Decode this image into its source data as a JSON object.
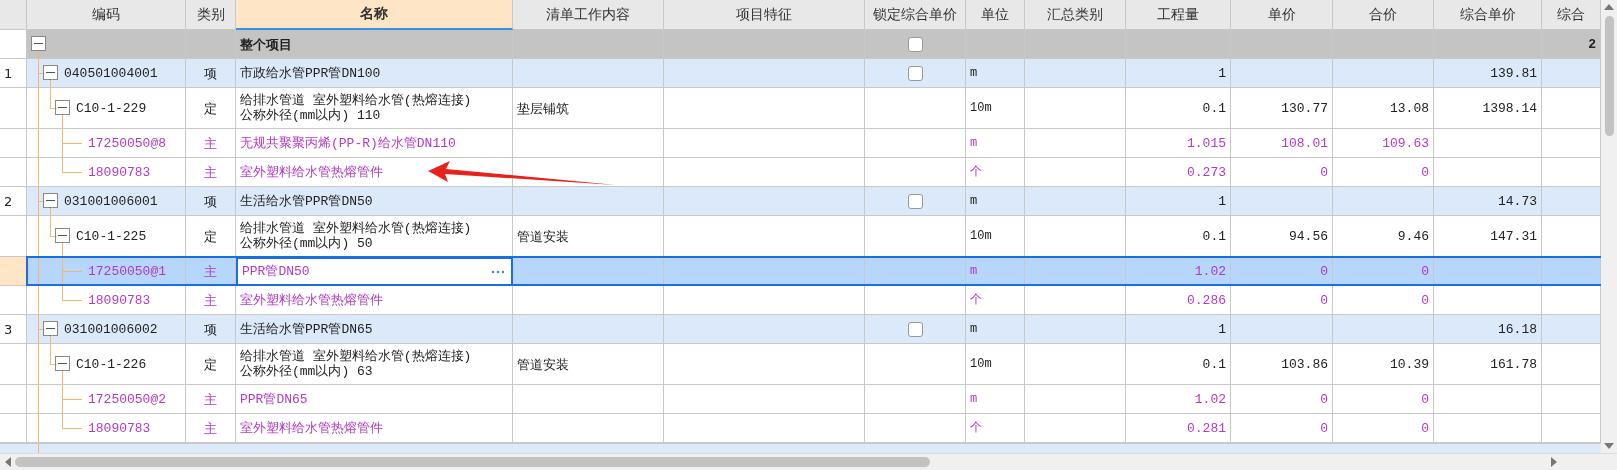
{
  "columns": [
    {
      "selected": false
    },
    {
      "label": "编码",
      "selected": false
    },
    {
      "label": "类别",
      "selected": false
    },
    {
      "label": "名称",
      "selected": true
    },
    {
      "label": "清单工作内容",
      "selected": false
    },
    {
      "label": "项目特征",
      "selected": false
    },
    {
      "label": "锁定综合单价",
      "selected": false
    },
    {
      "label": "单位",
      "selected": false
    },
    {
      "label": "汇总类别",
      "selected": false
    },
    {
      "label": "工程量",
      "selected": false
    },
    {
      "label": "单价",
      "selected": false
    },
    {
      "label": "合价",
      "selected": false
    },
    {
      "label": "综合单价",
      "selected": false
    },
    {
      "label": "综合",
      "selected": false
    }
  ],
  "rows": [
    {
      "kind": "root",
      "selected": false,
      "expanded": true,
      "locked": false,
      "name": "整个项目",
      "column_14": "2",
      "children": [
        {
          "kind": "item",
          "selected": false,
          "expanded": true,
          "locked": false,
          "index": "1",
          "code": "040501004001",
          "type": "项",
          "name": "市政给水管PPR管DN100",
          "unit": "m",
          "quantity": "1",
          "composite_unit_price": "139.81",
          "children": [
            {
              "kind": "def",
              "selected": false,
              "expanded": true,
              "code": "C10-1-229",
              "type": "定",
              "name": "给排水管道 室外塑料给水管(热熔连接)\n公称外径(mm以内) 110",
              "work_content": "垫层铺筑",
              "unit": "10m",
              "quantity": "0.1",
              "unit_price": "130.77",
              "total_price": "13.08",
              "composite_unit_price": "1398.14",
              "children": [
                {
                  "kind": "material",
                  "selected": false,
                  "code": "17250050@8",
                  "type": "主",
                  "name": "无规共聚聚丙烯(PP-R)给水管DN110",
                  "unit": "m",
                  "quantity": "1.015",
                  "unit_price": "108.01",
                  "total_price": "109.63"
                },
                {
                  "kind": "material",
                  "selected": false,
                  "code": "18090783",
                  "type": "主",
                  "name": "室外塑料给水管热熔管件",
                  "unit": "个",
                  "quantity": "0.273",
                  "unit_price": "0",
                  "total_price": "0"
                }
              ]
            }
          ]
        },
        {
          "kind": "item",
          "selected": false,
          "expanded": true,
          "locked": false,
          "index": "2",
          "code": "031001006001",
          "type": "项",
          "name": "生活给水管PPR管DN50",
          "unit": "m",
          "quantity": "1",
          "composite_unit_price": "14.73",
          "children": [
            {
              "kind": "def",
              "selected": false,
              "expanded": true,
              "code": "C10-1-225",
              "type": "定",
              "name": "给排水管道 室外塑料给水管(热熔连接)\n公称外径(mm以内) 50",
              "work_content": "管道安装",
              "unit": "10m",
              "quantity": "0.1",
              "unit_price": "94.56",
              "total_price": "9.46",
              "composite_unit_price": "147.31",
              "children": [
                {
                  "kind": "material",
                  "selected": true,
                  "code": "17250050@1",
                  "type": "主",
                  "name": "PPR管DN50",
                  "unit": "m",
                  "quantity": "1.02",
                  "unit_price": "0",
                  "total_price": "0"
                },
                {
                  "kind": "material",
                  "selected": false,
                  "code": "18090783",
                  "type": "主",
                  "name": "室外塑料给水管热熔管件",
                  "unit": "个",
                  "quantity": "0.286",
                  "unit_price": "0",
                  "total_price": "0"
                }
              ]
            }
          ]
        },
        {
          "kind": "item",
          "selected": false,
          "expanded": true,
          "locked": false,
          "index": "3",
          "code": "031001006002",
          "type": "项",
          "name": "生活给水管PPR管DN65",
          "unit": "m",
          "quantity": "1",
          "composite_unit_price": "16.18",
          "children": [
            {
              "kind": "def",
              "selected": false,
              "expanded": true,
              "code": "C10-1-226",
              "type": "定",
              "name": "给排水管道 室外塑料给水管(热熔连接)\n公称外径(mm以内) 63",
              "work_content": "管道安装",
              "unit": "10m",
              "quantity": "0.1",
              "unit_price": "103.86",
              "total_price": "10.39",
              "composite_unit_price": "161.78",
              "children": [
                {
                  "kind": "material",
                  "selected": false,
                  "code": "17250050@2",
                  "type": "主",
                  "name": "PPR管DN65",
                  "unit": "m",
                  "quantity": "1.02",
                  "unit_price": "0",
                  "total_price": "0"
                },
                {
                  "kind": "material",
                  "selected": false,
                  "code": "18090783",
                  "type": "主",
                  "name": "室外塑料给水管热熔管件",
                  "unit": "个",
                  "quantity": "0.281",
                  "unit_price": "0",
                  "total_price": "0"
                }
              ]
            }
          ]
        }
      ]
    }
  ]
}
